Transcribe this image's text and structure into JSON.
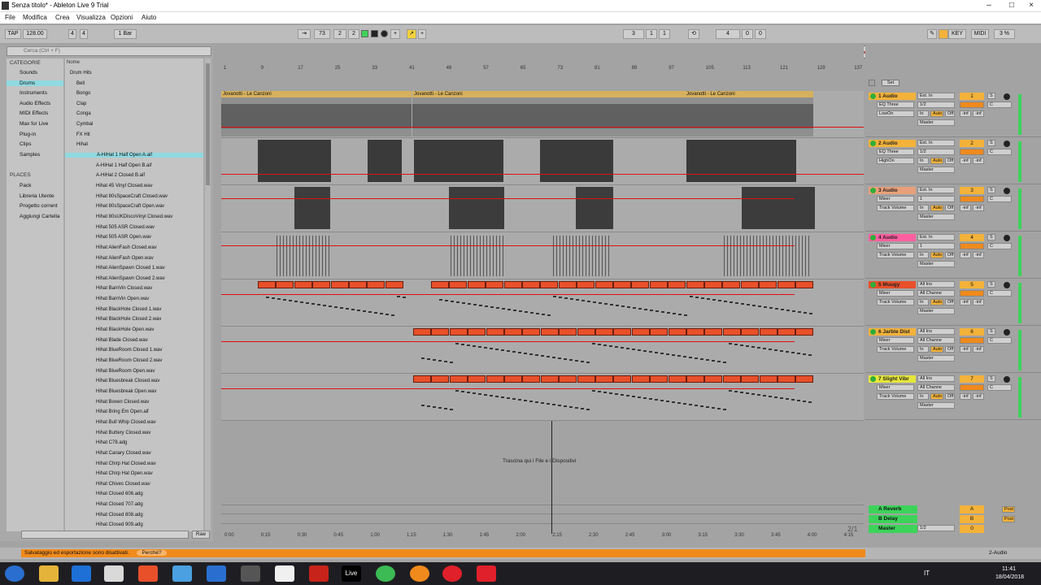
{
  "window": {
    "title": "Senza titolo* - Ableton Live 9 Trial"
  },
  "menu": [
    "File",
    "Modifica",
    "Crea",
    "Visualizza",
    "Opzioni",
    "Aiuto"
  ],
  "control_bar": {
    "tap": "TAP",
    "tempo": "128.00",
    "sig_num": "4",
    "sig_den": "4",
    "quant": "1 Bar",
    "pos1": "73",
    "pos2": "2",
    "pos3": "2",
    "loop1": "3",
    "loop2": "1",
    "loop3": "1",
    "len1": "4",
    "len2": "0",
    "len3": "0",
    "key": "KEY",
    "midi": "MIDI",
    "cpu": "3 %"
  },
  "browser": {
    "search_placeholder": "Cerca (Ctrl + F)",
    "categories_header": "CATEGORIE",
    "name_header": "Nome",
    "categories": [
      "Sounds",
      "Drums",
      "Instruments",
      "Audio Effects",
      "MIDI Effects",
      "Max for Live",
      "Plug-in",
      "Clips",
      "Samples"
    ],
    "places_header": "PLACES",
    "places": [
      "Pack",
      "Libreria Utente",
      "Progetto corrent",
      "Aggiungi Cartella"
    ],
    "folders": [
      "Drum Hits",
      "Bell",
      "Bongo",
      "Clap",
      "Conga",
      "Cymbal",
      "FX Hit",
      "Hihat"
    ],
    "files": [
      "A-HiHat 1 Half Open A.aif",
      "A-HiHat 1 Half Open B.aif",
      "A-HiHat 2 Closed B.aif",
      "Hihat 45 Vinyl Closed.wav",
      "Hihat 80sSpaceCraft Closed.wav",
      "Hihat 80sSpaceCraft Open.wav",
      "Hihat 80sUKDiscoVinyl Closed.wav",
      "Hihat 505 ASR Closed.wav",
      "Hihat 505 ASR Open.wav",
      "Hihat AlienFash Closed.wav",
      "Hihat AlienFash Open.wav",
      "Hihat AlienSpawn Closed 1.wav",
      "Hihat AlienSpawn Closed 2.wav",
      "Hihat BamVin Closed.wav",
      "Hihat BamVin Open.wav",
      "Hihat BlackHole Closed 1.wav",
      "Hihat BlackHole Closed 2.wav",
      "Hihat BlackHole Open.wav",
      "Hihat Blade Closed.wav",
      "Hihat BlueRoom Closed 1.wav",
      "Hihat BlueRoom Closed 2.wav",
      "Hihat BlueRoom Open.wav",
      "Hihat Bluesbreak Closed.wav",
      "Hihat Bluesbreak Open.wav",
      "Hihat Boxen Closed.wav",
      "Hihat Bring Em Open.aif",
      "Hihat Bull Whip Closed.wav",
      "Hihat Buttery Closed.wav",
      "Hihat C78.adg",
      "Hihat Canary Closed.wav",
      "Hihat Chirp Hat Closed.wav",
      "Hihat Chirp Hat Open.wav",
      "Hihat Chives Closed.wav",
      "Hihat Closed 606.adg",
      "Hihat Closed 707.adg",
      "Hihat Closed 808.adg",
      "Hihat Closed 909.adg"
    ],
    "preview_raw": "Raw"
  },
  "arrangement": {
    "ruler": [
      "1",
      "9",
      "17",
      "25",
      "33",
      "41",
      "49",
      "57",
      "65",
      "73",
      "81",
      "89",
      "97",
      "105",
      "113",
      "121",
      "129",
      "137"
    ],
    "time_ruler": [
      "0:00",
      "0:15",
      "0:30",
      "0:45",
      "1:00",
      "1:15",
      "1:30",
      "1:45",
      "2:00",
      "2:15",
      "2:30",
      "2:45",
      "3:00",
      "3:15",
      "3:30",
      "3:45",
      "4:00",
      "4:15"
    ],
    "clip_name": "Jovanotti - Le Canzoni",
    "drop_hint": "Trascina qui i File e i Dispositivi",
    "page": "2/1"
  },
  "tracks": [
    {
      "name": "1 Audio",
      "color": "#f3b23a",
      "num": "1",
      "dev": "EQ Three",
      "param": "LowOn",
      "input": "Ext. In",
      "ch": "1/2"
    },
    {
      "name": "2 Audio",
      "color": "#f3b23a",
      "num": "2",
      "dev": "EQ Three",
      "param": "HighOn",
      "input": "Ext. In",
      "ch": "1/2"
    },
    {
      "name": "3 Audio",
      "color": "#e8a07a",
      "num": "3",
      "dev": "Mixer",
      "param": "Track Volume",
      "input": "Ext. In",
      "ch": "1"
    },
    {
      "name": "4 Audio",
      "color": "#ff5fa0",
      "num": "4",
      "dev": "Mixer",
      "param": "Track Volume",
      "input": "Ext. In",
      "ch": "1"
    },
    {
      "name": "5 Muugy",
      "color": "#e8502a",
      "num": "5",
      "dev": "Mixer",
      "param": "Track Volume",
      "input": "All Ins",
      "ch": "All Channe"
    },
    {
      "name": "6 Jarble Dist",
      "color": "#f3b23a",
      "num": "6",
      "dev": "Mixer",
      "param": "Track Volume",
      "input": "All Ins",
      "ch": "All Channe"
    },
    {
      "name": "7 Slight Vibr",
      "color": "#e6e63a",
      "num": "7",
      "dev": "Mixer",
      "param": "Track Volume",
      "input": "All Ins",
      "ch": "All Channe"
    }
  ],
  "mixer_labels": {
    "set": "Set",
    "in": "In",
    "auto": "Auto",
    "off": "Off",
    "master": "Master",
    "s": "S",
    "c": "C",
    "inf": "-inf"
  },
  "returns": [
    {
      "name": "A Reverb",
      "letter": "A",
      "post": "Post"
    },
    {
      "name": "B Delay",
      "letter": "B",
      "post": "Post"
    },
    {
      "name": "Master",
      "letter": "0",
      "post": ""
    }
  ],
  "master_ch": "1/2",
  "status": {
    "message": "Salvataggio ed esportazione sono disattivati.",
    "why": "Perché?",
    "right": "2-Audio"
  },
  "taskbar": {
    "lang": "IT",
    "time": "11:41",
    "date": "18/04/2018",
    "live": "Live"
  }
}
